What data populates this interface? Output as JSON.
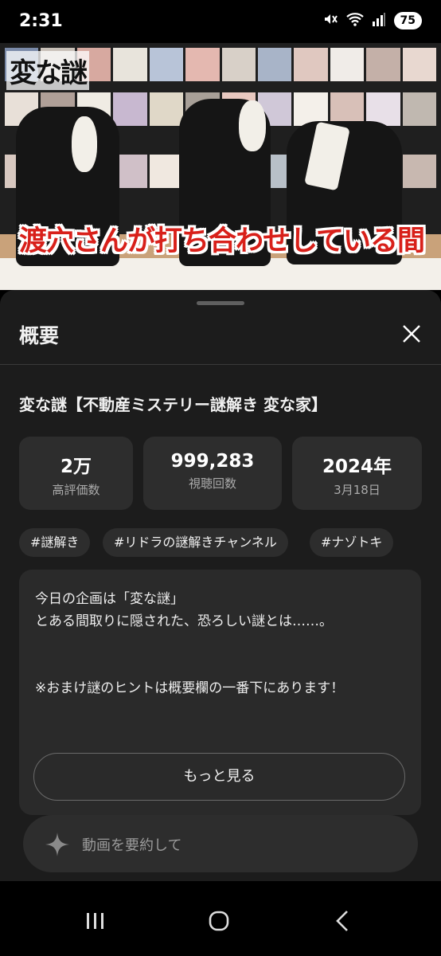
{
  "status_bar": {
    "time": "2:31",
    "battery": "75",
    "icons": [
      "mute-icon",
      "wifi-icon",
      "signal-icon",
      "battery-icon"
    ]
  },
  "video": {
    "logo_text": "変な謎",
    "caption": "渡穴さんが打ち合わせしている間"
  },
  "sheet": {
    "title": "概要",
    "video_title": "変な謎【不動産ミステリー謎解き 変な家】",
    "stats": [
      {
        "value": "2万",
        "label": "高評価数"
      },
      {
        "value": "999,283",
        "label": "視聴回数"
      },
      {
        "value": "2024年",
        "label": "3月18日"
      }
    ],
    "hashtags": [
      "#謎解き",
      "#リドラの謎解きチャンネル",
      "#ナゾトキ"
    ],
    "description": {
      "lines": [
        "今日の企画は「変な謎」",
        "とある間取りに隠された、恐ろしい謎とは……。",
        "※おまけ謎のヒントは概要欄の一番下にあります！"
      ],
      "more_label": "もっと見る"
    },
    "summary_placeholder": "動画を要約して"
  },
  "nav": {
    "icons": [
      "recent-apps-icon",
      "home-icon",
      "back-icon"
    ]
  },
  "colors": {
    "sheet_bg": "#1c1c1c",
    "card_bg": "#2d2d2d",
    "caption_red": "#d8201a"
  }
}
